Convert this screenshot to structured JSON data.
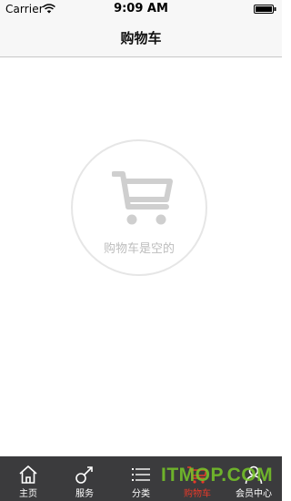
{
  "status_bar": {
    "carrier": "Carrier",
    "time": "9:09 AM",
    "wifi_icon": "wifi-icon",
    "battery_icon": "battery-icon"
  },
  "header": {
    "title": "购物车"
  },
  "empty_state": {
    "icon": "shopping-cart-icon",
    "message": "购物车是空的"
  },
  "tab_bar": {
    "active_color": "#e63a2a",
    "background": "#3b3b3d",
    "tabs": [
      {
        "label": "主页",
        "icon": "home-icon"
      },
      {
        "label": "服务",
        "icon": "wrench-icon"
      },
      {
        "label": "分类",
        "icon": "list-icon"
      },
      {
        "label": "购物车",
        "icon": "cart-icon",
        "active": true
      },
      {
        "label": "会员中心",
        "icon": "user-icon"
      }
    ]
  },
  "watermark": "ITMOP.COM"
}
